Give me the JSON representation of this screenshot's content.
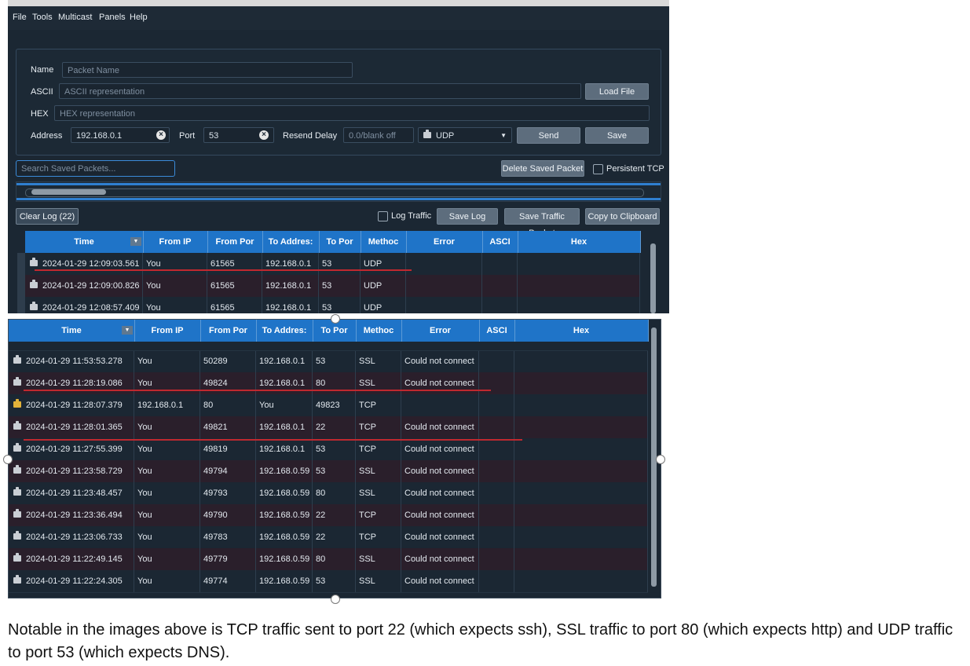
{
  "menu": [
    "File",
    "Tools",
    "Multicast",
    "Panels",
    "Help"
  ],
  "packet_form": {
    "name_label": "Name",
    "name_placeholder": "Packet Name",
    "ascii_label": "ASCII",
    "ascii_placeholder": "ASCII representation",
    "load_file_label": "Load File",
    "hex_label": "HEX",
    "hex_placeholder": "HEX representation",
    "address_label": "Address",
    "address_value": "192.168.0.1",
    "port_label": "Port",
    "port_value": "53",
    "resend_label": "Resend Delay",
    "resend_placeholder": "0.0/blank off",
    "method_value": "UDP",
    "send_label": "Send",
    "save_label": "Save"
  },
  "saved": {
    "search_placeholder": "Search Saved Packets...",
    "delete_label": "Delete Saved Packet",
    "persistent_label": "Persistent TCP"
  },
  "log_toolbar": {
    "clear_label": "Clear Log (22)",
    "log_traffic_label": "Log Traffic",
    "save_log_label": "Save Log",
    "save_traffic_label": "Save Traffic Packet",
    "copy_label": "Copy to Clipboard"
  },
  "columns": [
    "Time",
    "From IP",
    "From Por",
    "To Addres:",
    "To Por",
    "Methoc",
    "Error",
    "ASCI",
    "Hex"
  ],
  "table_top": [
    {
      "time": "2024-01-29 12:09:03.561",
      "from_ip": "You",
      "from_port": "61565",
      "to_addr": "192.168.0.1",
      "to_port": "53",
      "method": "UDP",
      "error": "",
      "dir": "out"
    },
    {
      "time": "2024-01-29 12:09:00.826",
      "from_ip": "You",
      "from_port": "61565",
      "to_addr": "192.168.0.1",
      "to_port": "53",
      "method": "UDP",
      "error": "",
      "dir": "out"
    },
    {
      "time": "2024-01-29 12:08:57.409",
      "from_ip": "You",
      "from_port": "61565",
      "to_addr": "192.168.0.1",
      "to_port": "53",
      "method": "UDP",
      "error": "",
      "dir": "out"
    }
  ],
  "table_bottom": [
    {
      "time": "2024-01-29 11:53:53.278",
      "from_ip": "You",
      "from_port": "50289",
      "to_addr": "192.168.0.1",
      "to_port": "53",
      "method": "SSL",
      "error": "Could not connect",
      "dir": "out"
    },
    {
      "time": "2024-01-29 11:28:19.086",
      "from_ip": "You",
      "from_port": "49824",
      "to_addr": "192.168.0.1",
      "to_port": "80",
      "method": "SSL",
      "error": "Could not connect",
      "dir": "out"
    },
    {
      "time": "2024-01-29 11:28:07.379",
      "from_ip": "192.168.0.1",
      "from_port": "80",
      "to_addr": "You",
      "to_port": "49823",
      "method": "TCP",
      "error": "",
      "dir": "in"
    },
    {
      "time": "2024-01-29 11:28:01.365",
      "from_ip": "You",
      "from_port": "49821",
      "to_addr": "192.168.0.1",
      "to_port": "22",
      "method": "TCP",
      "error": "Could not connect",
      "dir": "out"
    },
    {
      "time": "2024-01-29 11:27:55.399",
      "from_ip": "You",
      "from_port": "49819",
      "to_addr": "192.168.0.1",
      "to_port": "53",
      "method": "TCP",
      "error": "Could not connect",
      "dir": "out"
    },
    {
      "time": "2024-01-29 11:23:58.729",
      "from_ip": "You",
      "from_port": "49794",
      "to_addr": "192.168.0.59",
      "to_port": "53",
      "method": "SSL",
      "error": "Could not connect",
      "dir": "out"
    },
    {
      "time": "2024-01-29 11:23:48.457",
      "from_ip": "You",
      "from_port": "49793",
      "to_addr": "192.168.0.59",
      "to_port": "80",
      "method": "SSL",
      "error": "Could not connect",
      "dir": "out"
    },
    {
      "time": "2024-01-29 11:23:36.494",
      "from_ip": "You",
      "from_port": "49790",
      "to_addr": "192.168.0.59",
      "to_port": "22",
      "method": "TCP",
      "error": "Could not connect",
      "dir": "out"
    },
    {
      "time": "2024-01-29 11:23:06.733",
      "from_ip": "You",
      "from_port": "49783",
      "to_addr": "192.168.0.59",
      "to_port": "22",
      "method": "TCP",
      "error": "Could not connect",
      "dir": "out"
    },
    {
      "time": "2024-01-29 11:22:49.145",
      "from_ip": "You",
      "from_port": "49779",
      "to_addr": "192.168.0.59",
      "to_port": "80",
      "method": "SSL",
      "error": "Could not connect",
      "dir": "out"
    },
    {
      "time": "2024-01-29 11:22:24.305",
      "from_ip": "You",
      "from_port": "49774",
      "to_addr": "192.168.0.59",
      "to_port": "53",
      "method": "SSL",
      "error": "Could not connect",
      "dir": "out"
    }
  ],
  "caption": "Notable in the images above is TCP traffic sent to port 22 (which expects ssh), SSL traffic to port 80 (which expects http) and UDP traffic to port 53 (which expects DNS).",
  "colors": {
    "header": "#1f74c8",
    "annotation": "#c0282f",
    "background": "#1b2733"
  }
}
